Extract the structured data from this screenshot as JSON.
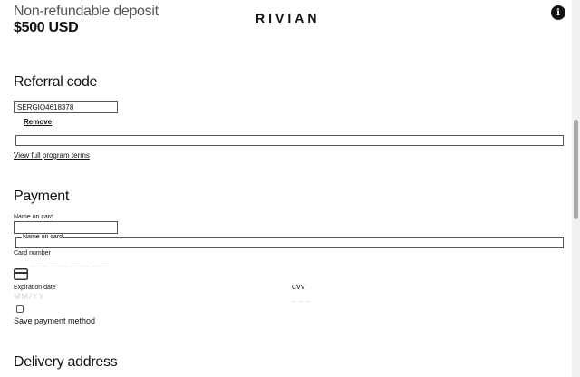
{
  "header": {
    "deposit_title": "Non-refundable deposit",
    "deposit_amount": "$500 USD",
    "logo_text": "RIVIAN",
    "info_glyph": "i"
  },
  "referral": {
    "heading": "Referral code",
    "code_value": "SERGIO4618378",
    "remove_label": "Remove",
    "terms_link": "View full program terms"
  },
  "payment": {
    "heading": "Payment",
    "name_label": "Name on card",
    "name_value": "",
    "name_legend": "Name on card",
    "card_number_label": "Card number",
    "card_number_placeholder": "____ ____ ____ ____",
    "card_icon": "credit-card-icon",
    "expiration_label": "Expiration date",
    "expiration_placeholder": "MM/YY",
    "cvv_label": "CVV",
    "cvv_placeholder": "_ _ _",
    "save_method_label": "Save payment method",
    "save_method_checked": false
  },
  "delivery": {
    "heading": "Delivery address"
  },
  "colors": {
    "text": "#111111",
    "muted": "#555555",
    "placeholder": "#cfcfcf",
    "border": "#555555",
    "scrollbar_thumb": "#a8a8a8"
  }
}
